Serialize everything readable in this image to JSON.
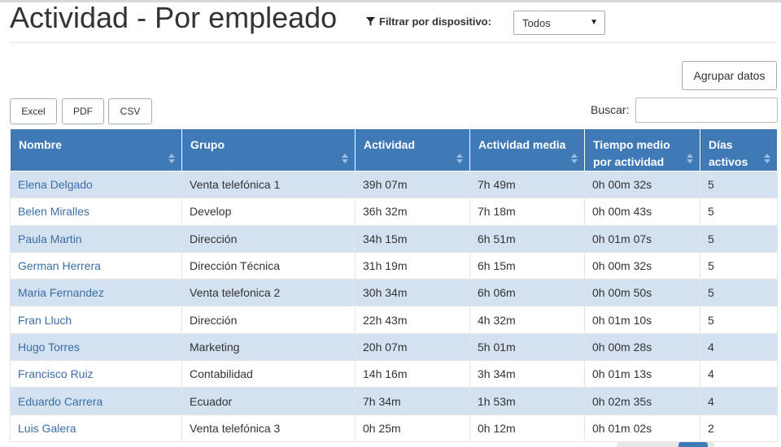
{
  "page": {
    "title": "Actividad - Por empleado"
  },
  "filter": {
    "label": "Filtrar por dispositivo:",
    "selected": "Todos"
  },
  "actions": {
    "group_label": "Agrupar datos"
  },
  "export": {
    "excel": "Excel",
    "pdf": "PDF",
    "csv": "CSV"
  },
  "search": {
    "label": "Buscar:",
    "value": ""
  },
  "table": {
    "headers": [
      "Nombre",
      "Grupo",
      "Actividad",
      "Actividad media",
      "Tiempo medio por actividad",
      "Días activos"
    ],
    "rows": [
      [
        "Elena Delgado",
        "Venta telefónica 1",
        "39h 07m",
        "7h 49m",
        "0h 00m 32s",
        "5"
      ],
      [
        "Belen Miralles",
        "Develop",
        "36h 32m",
        "7h 18m",
        "0h 00m 43s",
        "5"
      ],
      [
        "Paula Martin",
        "Dirección",
        "34h 15m",
        "6h 51m",
        "0h 01m 07s",
        "5"
      ],
      [
        "German Herrera",
        "Dirección Técnica",
        "31h 19m",
        "6h 15m",
        "0h 00m 32s",
        "5"
      ],
      [
        "Maria Fernandez",
        "Venta telefonica 2",
        "30h 34m",
        "6h 06m",
        "0h 00m 50s",
        "5"
      ],
      [
        "Fran Lluch",
        "Dirección",
        "22h 43m",
        "4h 32m",
        "0h 01m 10s",
        "5"
      ],
      [
        "Hugo Torres",
        "Marketing",
        "20h 07m",
        "5h 01m",
        "0h 00m 28s",
        "4"
      ],
      [
        "Francisco Ruiz",
        "Contabilidad",
        "14h 16m",
        "3h 34m",
        "0h 01m 13s",
        "4"
      ],
      [
        "Eduardo Carrera",
        "Ecuador",
        "7h 34m",
        "1h 53m",
        "0h 02m 35s",
        "4"
      ],
      [
        "Luis Galera",
        "Venta telefónica 3",
        "0h 25m",
        "0h 12m",
        "0h 01m 02s",
        "2"
      ]
    ]
  },
  "colors": {
    "header_bg": "#3f7ab7",
    "row_odd": "#d3e1f1",
    "link": "#3a6ea5"
  },
  "icons": {
    "filter": "filter-icon",
    "sort": "sort-icon",
    "dropdown": "chevron-down-icon"
  }
}
